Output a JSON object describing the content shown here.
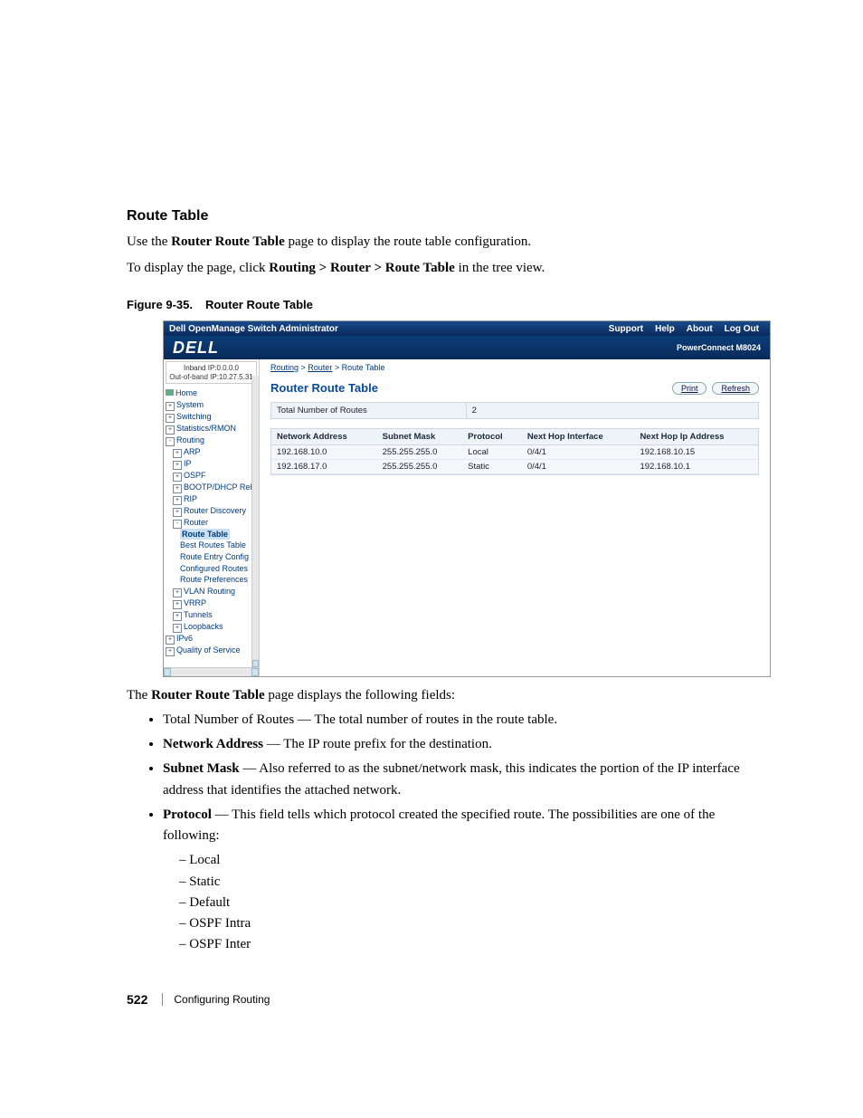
{
  "doc": {
    "section_heading": "Route Table",
    "intro_1_pre": "Use the ",
    "intro_1_bold": "Router Route Table",
    "intro_1_post": " page to display the route table configuration.",
    "intro_2_pre": "To display the page, click ",
    "intro_2_bold": "Routing > Router > Route Table",
    "intro_2_post": " in the tree view.",
    "figure_caption_num": "Figure 9-35.",
    "figure_caption_title": "Router Route Table",
    "after_fig_pre": "The ",
    "after_fig_bold": "Router Route Table",
    "after_fig_post": " page displays the following fields:",
    "bullets": {
      "b1_pre": "Total Number of Routes — The total number of routes in the route table.",
      "b2_label": "Network Address",
      "b2_post": " — The IP route prefix for the destination.",
      "b3_label": "Subnet Mask",
      "b3_post": " — Also referred to as the subnet/network mask, this indicates the portion of the IP interface address that identifies the attached network.",
      "b4_label": "Protocol",
      "b4_post": " — This field tells which protocol created the specified route. The possibilities are one of the following:",
      "sub": [
        "Local",
        "Static",
        "Default",
        "OSPF Intra",
        "OSPF Inter"
      ]
    },
    "page_number": "522",
    "footer_section": "Configuring Routing"
  },
  "app": {
    "window_title": "Dell OpenManage Switch Administrator",
    "topnav": [
      "Support",
      "Help",
      "About",
      "Log Out"
    ],
    "logo_text": "DELL",
    "product": "PowerConnect M8024",
    "ip_inband": "Inband IP:0.0.0.0",
    "ip_oob": "Out-of-band IP:10.27.5.31",
    "breadcrumb": [
      "Routing",
      "Router",
      "Route Table"
    ],
    "panel_title": "Router Route Table",
    "buttons": {
      "print": "Print",
      "refresh": "Refresh"
    },
    "total_label": "Total Number of Routes",
    "total_value": "2",
    "columns": [
      "Network Address",
      "Subnet Mask",
      "Protocol",
      "Next Hop Interface",
      "Next Hop Ip Address"
    ],
    "rows": [
      {
        "net": "192.168.10.0",
        "mask": "255.255.255.0",
        "proto": "Local",
        "hopif": "0/4/1",
        "hopip": "192.168.10.15"
      },
      {
        "net": "192.168.17.0",
        "mask": "255.255.255.0",
        "proto": "Static",
        "hopif": "0/4/1",
        "hopip": "192.168.10.1"
      }
    ],
    "tree": {
      "home": "Home",
      "system": "System",
      "switching": "Switching",
      "stats": "Statistics/RMON",
      "routing": "Routing",
      "arp": "ARP",
      "ip": "IP",
      "ospf": "OSPF",
      "bootp": "BOOTP/DHCP Relay",
      "rip": "RIP",
      "router_disc": "Router Discovery",
      "router": "Router",
      "route_table": "Route Table",
      "best_routes": "Best Routes Table",
      "route_entry": "Route Entry Config",
      "configured_routes": "Configured Routes",
      "route_prefs": "Route Preferences",
      "vlan_routing": "VLAN Routing",
      "vrrp": "VRRP",
      "tunnels": "Tunnels",
      "loopbacks": "Loopbacks",
      "ipv6": "IPv6",
      "qos": "Quality of Service"
    }
  }
}
